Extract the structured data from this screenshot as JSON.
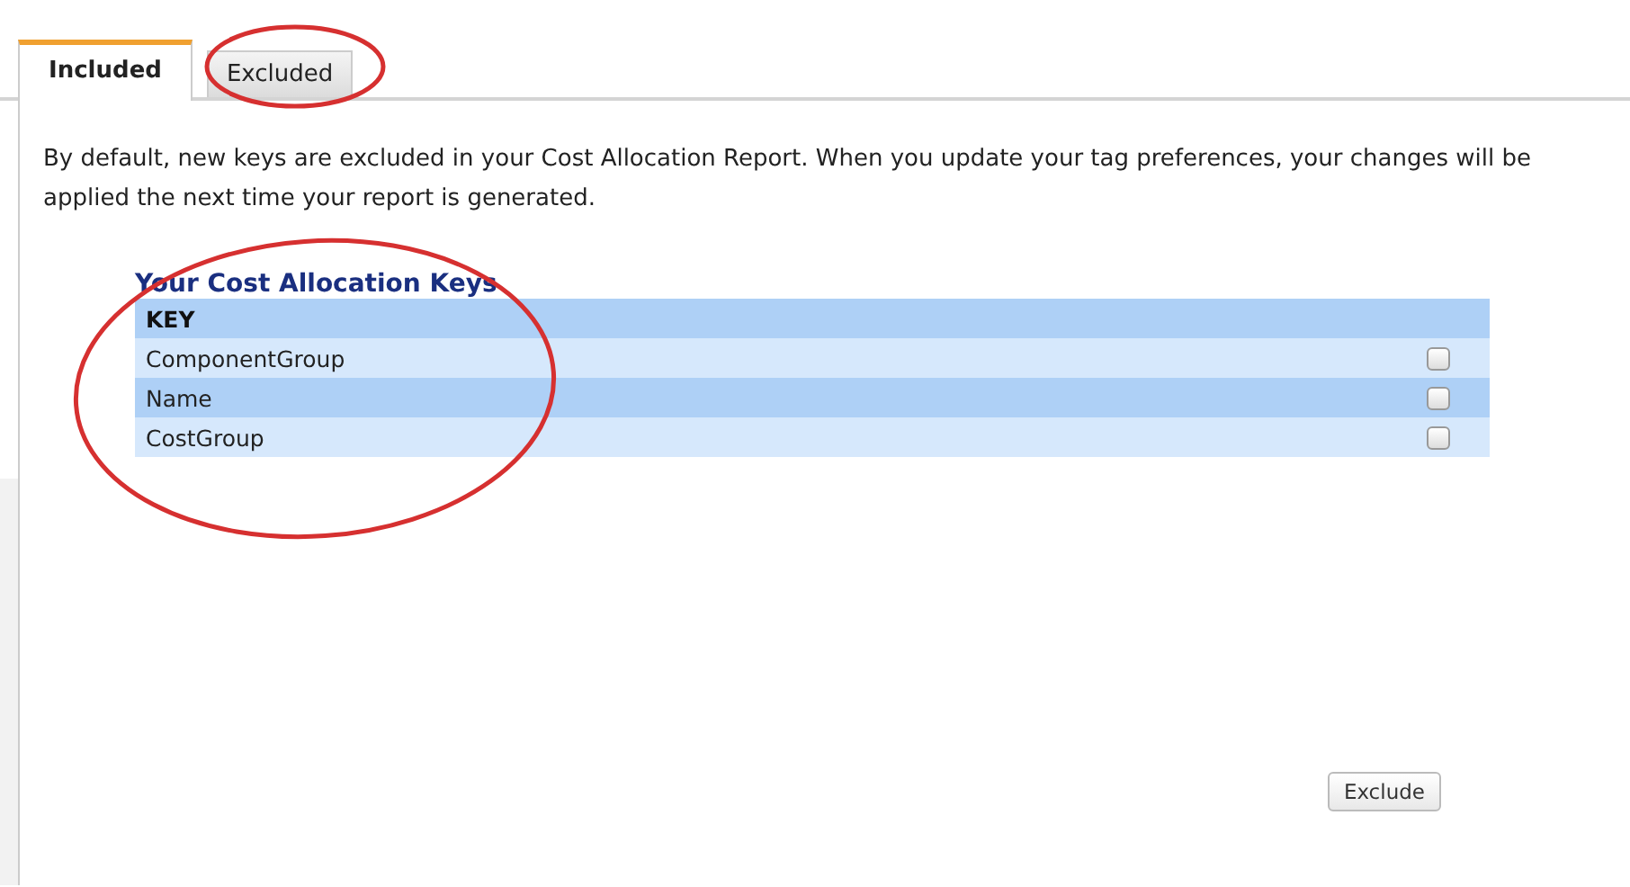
{
  "tabs": [
    {
      "label": "Included",
      "selected": true
    },
    {
      "label": "Excluded",
      "selected": false
    }
  ],
  "description": "By default, new keys are excluded in your Cost Allocation Report. When you update your tag preferences, your changes will be applied the next time your report is generated.",
  "section_title": "Your Cost Allocation Keys",
  "table": {
    "columns": [
      "KEY"
    ],
    "rows": [
      {
        "key": "ComponentGroup",
        "checked": false
      },
      {
        "key": "Name",
        "checked": false
      },
      {
        "key": "CostGroup",
        "checked": false
      }
    ]
  },
  "button": "Exclude"
}
